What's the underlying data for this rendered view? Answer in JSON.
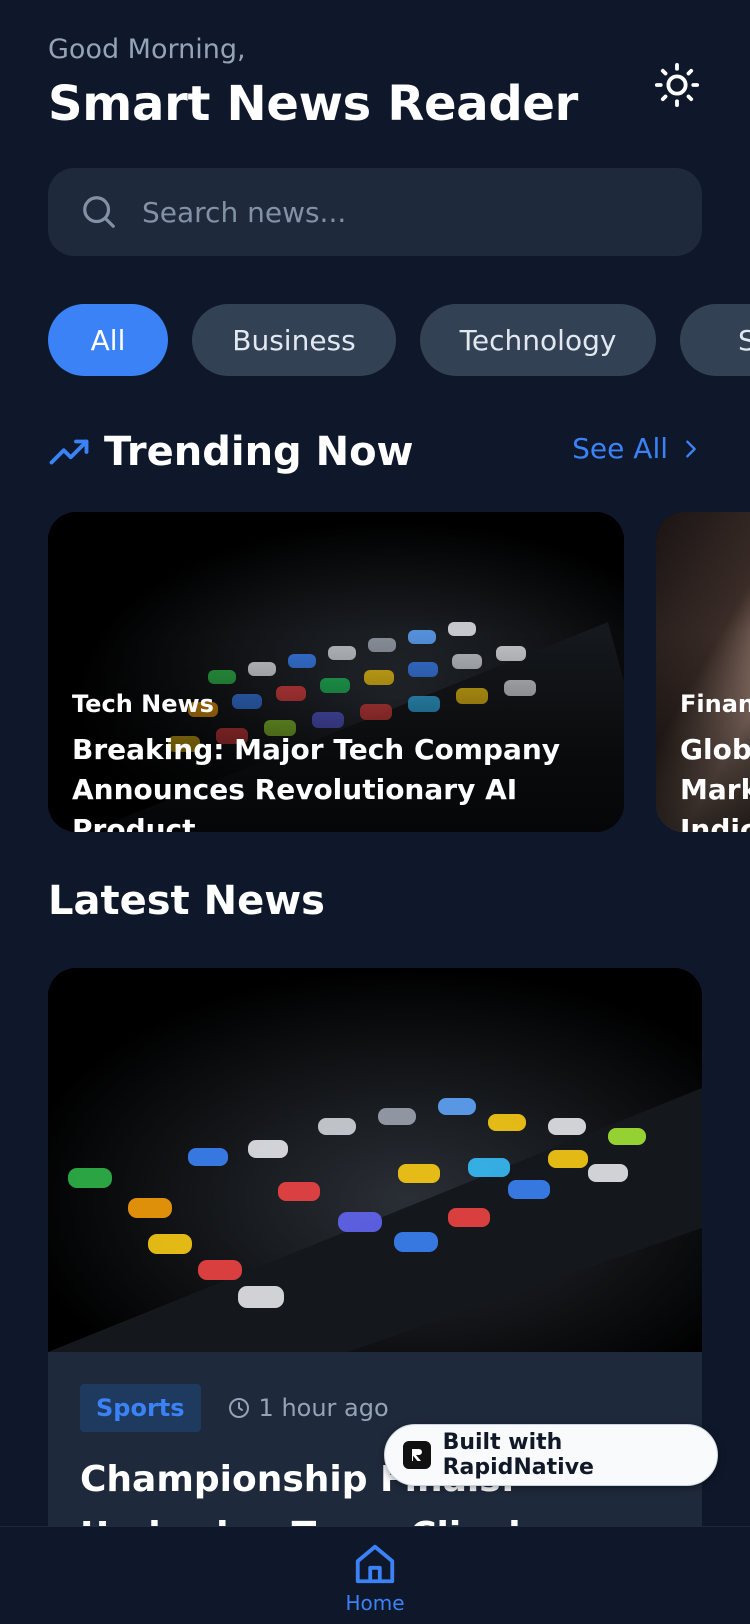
{
  "header": {
    "greeting": "Good Morning,",
    "title": "Smart News Reader"
  },
  "search": {
    "placeholder": "Search news..."
  },
  "categories": [
    "All",
    "Business",
    "Technology",
    "S"
  ],
  "trending": {
    "title": "Trending Now",
    "see_all": "See All",
    "cards": [
      {
        "category": "Tech News",
        "title": "Breaking: Major Tech Company Announces Revolutionary AI Product"
      },
      {
        "category": "Finance",
        "title": "Global Market Indicators"
      }
    ]
  },
  "latest": {
    "title": "Latest News",
    "card": {
      "category": "Sports",
      "time": "1 hour ago",
      "title": "Championship Finals: Underdog Team Clinches Historic Victory"
    }
  },
  "built_badge": "Built with RapidNative",
  "nav": {
    "home": "Home"
  },
  "colors": {
    "accent": "#3b82f6",
    "background": "#0f172a",
    "surface": "#1e293b"
  }
}
